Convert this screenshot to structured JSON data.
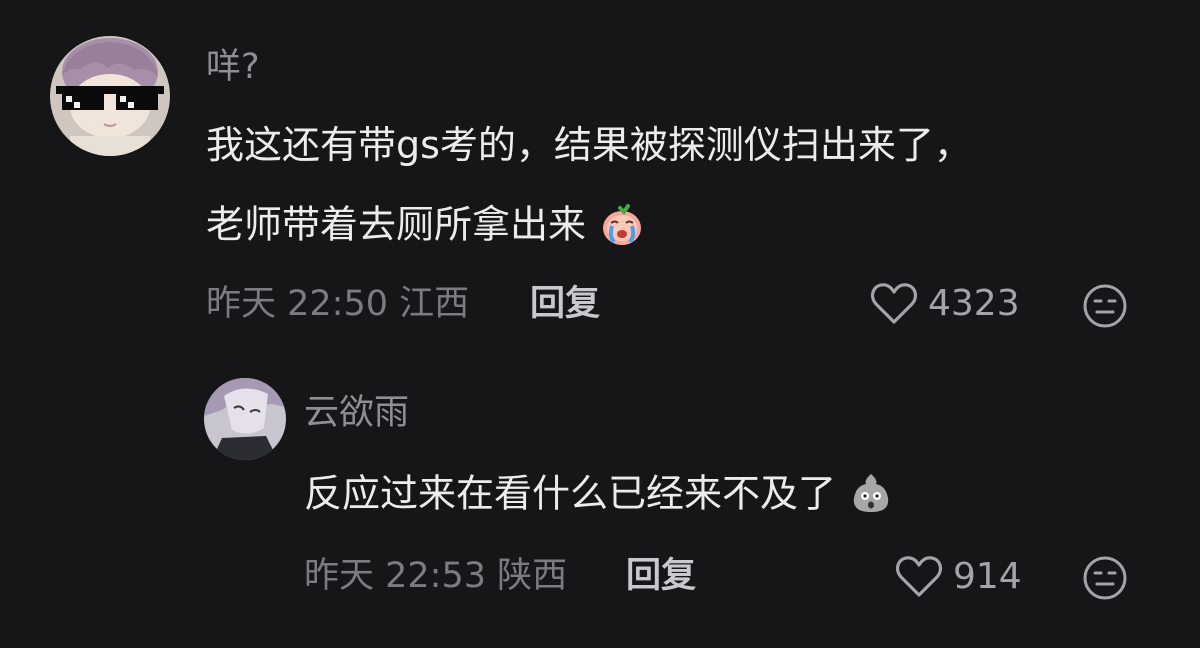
{
  "comments": [
    {
      "username": "咩?",
      "content_lines": [
        "我这还有带gs考的，结果被探测仪扫出来了，",
        "老师带着去厕所拿出来"
      ],
      "content_emoji": "crying-peach-emoji",
      "time": "昨天 22:50",
      "location": "江西",
      "reply_label": "回复",
      "like_count": "4323",
      "avatar_icon": "sunglasses-doll-avatar"
    },
    {
      "username": "云欲雨",
      "content": "反应过来在看什么已经来不及了",
      "content_emoji": "shocked-face-emoji",
      "time": "昨天 22:53",
      "location": "陕西",
      "reply_label": "回复",
      "like_count": "914",
      "avatar_icon": "anime-character-avatar"
    }
  ],
  "icons": {
    "like": "heart-outline-icon",
    "dislike": "neutral-face-icon"
  },
  "colors": {
    "background": "#161618",
    "username": "#8e8e93",
    "content": "#ececee",
    "meta": "#7b7b80"
  }
}
